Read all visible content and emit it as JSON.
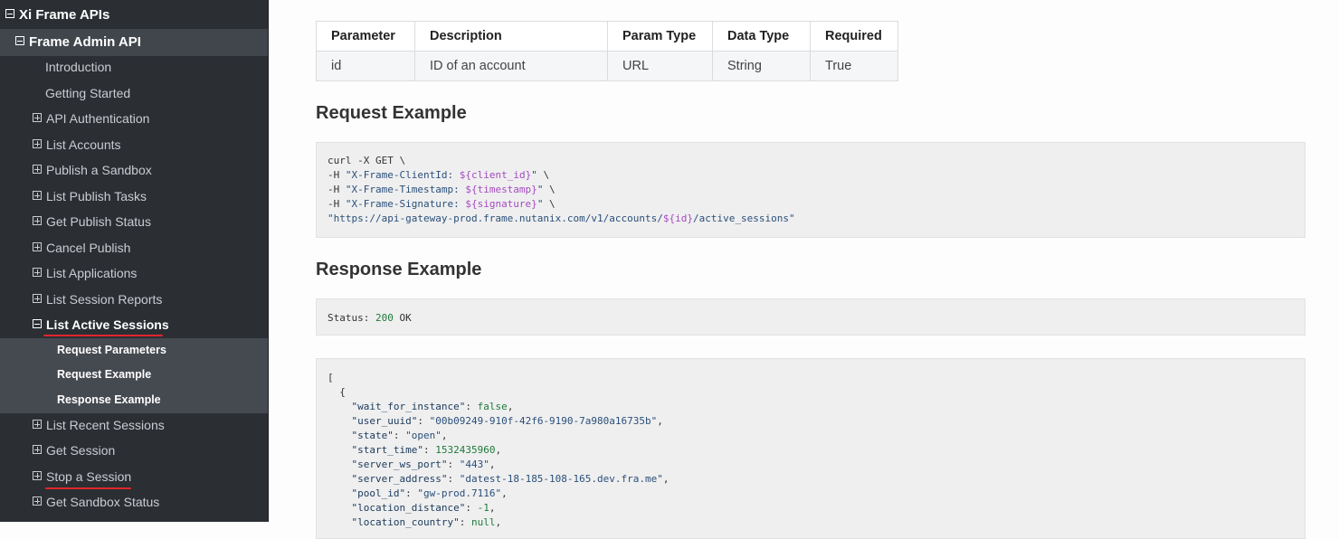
{
  "sidebar": {
    "root_label": "Xi Frame APIs",
    "section_label": "Frame Admin API",
    "items": [
      {
        "label": "Introduction",
        "expandable": false
      },
      {
        "label": "Getting Started",
        "expandable": false
      },
      {
        "label": "API Authentication",
        "expandable": true
      },
      {
        "label": "List Accounts",
        "expandable": true
      },
      {
        "label": "Publish a Sandbox",
        "expandable": true
      },
      {
        "label": "List Publish Tasks",
        "expandable": true
      },
      {
        "label": "Get Publish Status",
        "expandable": true
      },
      {
        "label": "Cancel Publish",
        "expandable": true
      },
      {
        "label": "List Applications",
        "expandable": true
      },
      {
        "label": "List Session Reports",
        "expandable": true
      },
      {
        "label": "List Active Sessions",
        "expandable": true,
        "active": true
      },
      {
        "label": "List Recent Sessions",
        "expandable": true
      },
      {
        "label": "Get Session",
        "expandable": true
      },
      {
        "label": "Stop a Session",
        "expandable": true
      },
      {
        "label": "Get Sandbox Status",
        "expandable": true
      }
    ],
    "subitems": [
      "Request Parameters",
      "Request Example",
      "Response Example"
    ]
  },
  "params_table": {
    "headers": [
      "Parameter",
      "Description",
      "Param Type",
      "Data Type",
      "Required"
    ],
    "rows": [
      [
        "id",
        "ID of an account",
        "URL",
        "String",
        "True"
      ]
    ]
  },
  "request_heading": "Request Example",
  "request_code": {
    "line1": "curl -X GET \\",
    "line2_pre": "-H ",
    "line2_str_a": "\"X-Frame-ClientId: ",
    "line2_var": "${client_id}",
    "line2_str_b": "\"",
    "line2_post": " \\",
    "line3_pre": "-H ",
    "line3_str_a": "\"X-Frame-Timestamp: ",
    "line3_var": "${timestamp}",
    "line3_str_b": "\"",
    "line3_post": " \\",
    "line4_pre": "-H ",
    "line4_str_a": "\"X-Frame-Signature: ",
    "line4_var": "${signature}",
    "line4_str_b": "\"",
    "line4_post": " \\",
    "line5_str_a": "\"https://api-gateway-prod.frame.nutanix.com/v1/accounts/",
    "line5_var": "${id}",
    "line5_str_b": "/active_sessions\""
  },
  "response_heading": "Response Example",
  "status": {
    "label": "Status: ",
    "code": "200",
    "text": " OK"
  },
  "response_json": [
    {
      "key": "\"wait_for_instance\"",
      "value": "false",
      "type": "kw"
    },
    {
      "key": "\"user_uuid\"",
      "value": "\"00b09249-910f-42f6-9190-7a980a16735b\"",
      "type": "str"
    },
    {
      "key": "\"state\"",
      "value": "\"open\"",
      "type": "str"
    },
    {
      "key": "\"start_time\"",
      "value": "1532435960",
      "type": "num"
    },
    {
      "key": "\"server_ws_port\"",
      "value": "\"443\"",
      "type": "str"
    },
    {
      "key": "\"server_address\"",
      "value": "\"datest-18-185-108-165.dev.fra.me\"",
      "type": "str"
    },
    {
      "key": "\"pool_id\"",
      "value": "\"gw-prod.7116\"",
      "type": "str"
    },
    {
      "key": "\"location_distance\"",
      "value": "-1",
      "type": "num"
    },
    {
      "key": "\"location_country\"",
      "value": "null",
      "type": "kw"
    }
  ],
  "json_open_bracket": "[",
  "json_open_brace": "{",
  "colors": {
    "sidebar_bg": "#2b2f34",
    "active_underline": "#e0262b",
    "code_bg": "#efefef"
  }
}
